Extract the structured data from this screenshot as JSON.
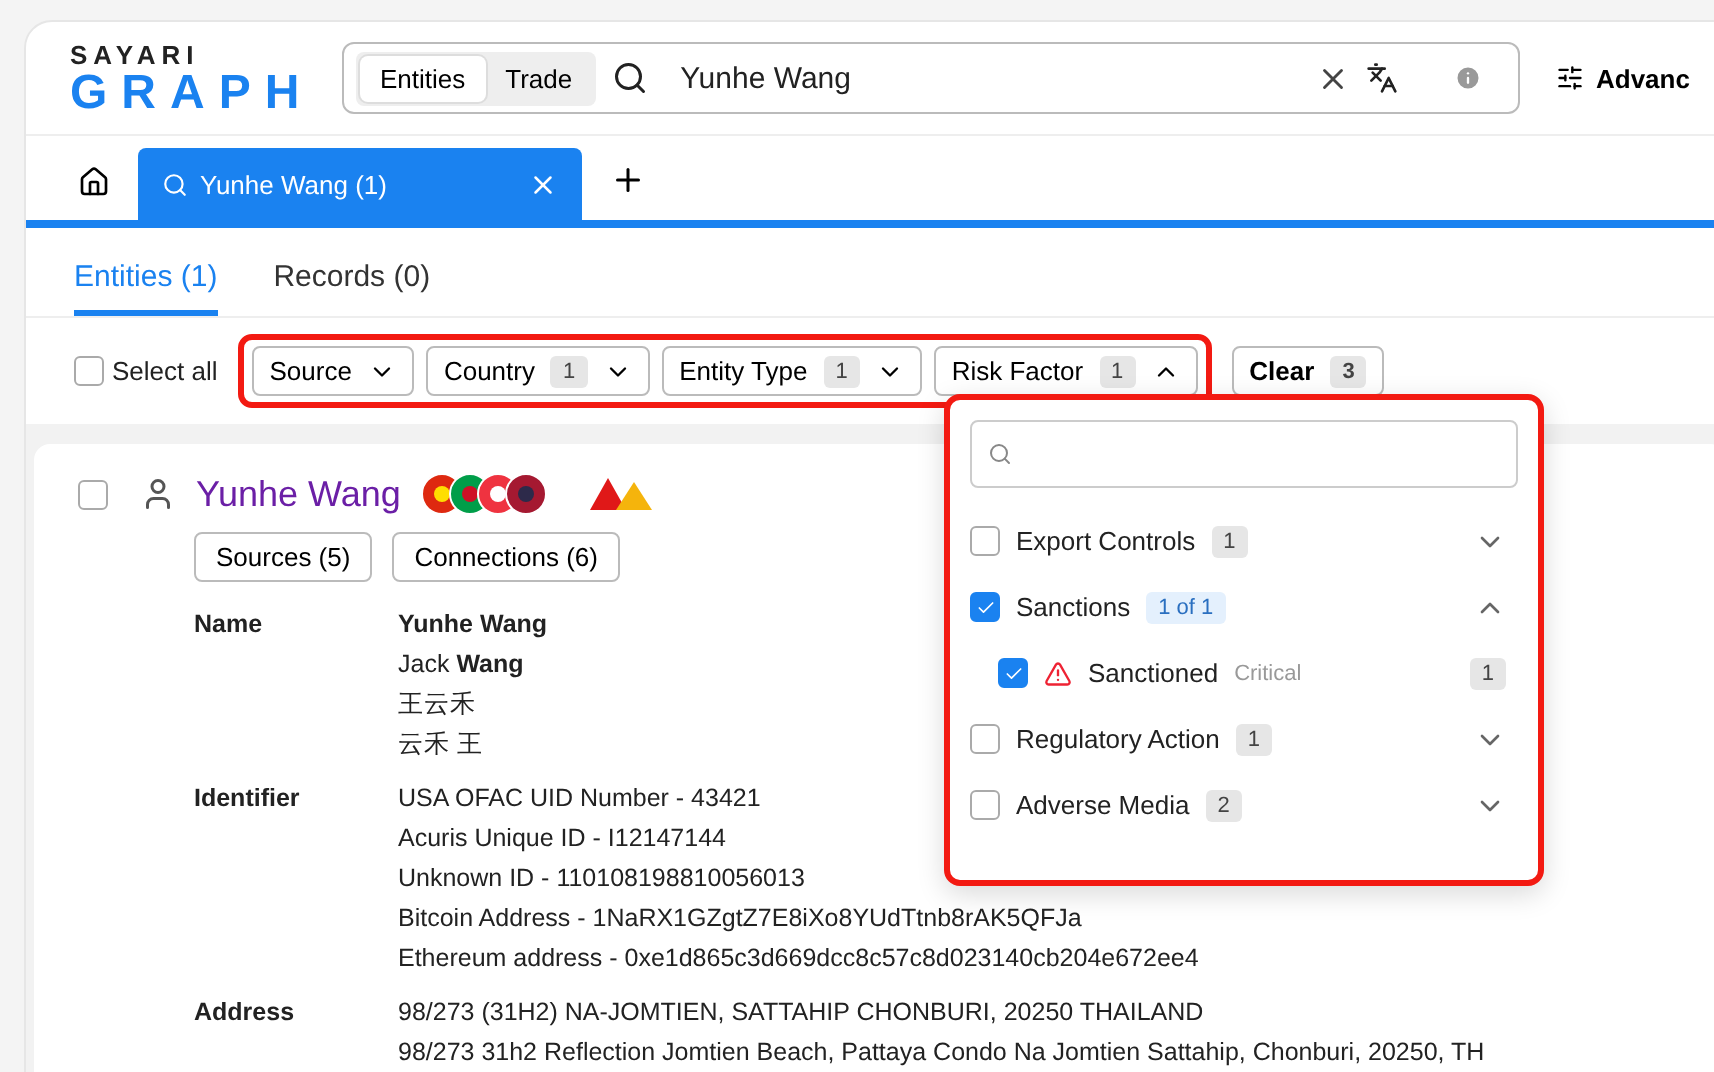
{
  "logo": {
    "top": "SAYARI",
    "bottom": "GRAPH"
  },
  "search": {
    "modes": [
      {
        "label": "Entities",
        "selected": true
      },
      {
        "label": "Trade",
        "selected": false
      }
    ],
    "value": "Yunhe Wang",
    "advanced": "Advanc"
  },
  "tabs": [
    {
      "label": "Yunhe Wang (1)",
      "selected": true
    }
  ],
  "result_tabs": [
    {
      "label": "Entities (1)",
      "selected": true
    },
    {
      "label": "Records (0)",
      "selected": false
    }
  ],
  "filters": {
    "select_all": {
      "label": "Select all",
      "checked": false
    },
    "items": [
      {
        "label": "Source",
        "open": false
      },
      {
        "label": "Country",
        "count": "1",
        "open": false
      },
      {
        "label": "Entity Type",
        "count": "1",
        "open": false
      },
      {
        "label": "Risk Factor",
        "count": "1",
        "open": true
      }
    ],
    "clear": {
      "label": "Clear",
      "count": "3"
    }
  },
  "entity": {
    "name": "Yunhe Wang",
    "checked": false,
    "flags": [
      {
        "kind": "china"
      },
      {
        "kind": "kitts"
      },
      {
        "kind": "singapore"
      },
      {
        "kind": "thailand"
      }
    ],
    "buttons": [
      "Sources (5)",
      "Connections (6)"
    ],
    "fields": [
      {
        "label": "Name",
        "values": [
          "**Yunhe Wang**",
          "Jack **Wang**",
          "王云禾",
          "云禾 王"
        ]
      },
      {
        "label": "Identifier",
        "values": [
          "USA OFAC UID Number - 43421",
          "Acuris Unique ID - I12147144",
          "Unknown ID - 110108198810056013",
          "Bitcoin Address - 1NaRX1GZgtZ7E8iXo8YUdTtnb8rAK5QFJa",
          "Ethereum address - 0xe1d865c3d669dcc8c57c8d023140cb204e672ee4"
        ]
      },
      {
        "label": "Address",
        "values": [
          "98/273 (31H2) NA-JOMTIEN, SATTAHIP CHONBURI, 20250 THAILAND",
          "98/273 31h2 Reflection Jomtien Beach, Pattaya Condo Na Jomtien Sattahip, Chonburi, 20250, TH"
        ]
      }
    ]
  },
  "risk_menu": {
    "items": [
      {
        "label": "Export Controls",
        "count": "1",
        "checked": false,
        "expanded": false
      },
      {
        "label": "Sanctions",
        "count": "1 of 1",
        "checked": true,
        "expanded": true,
        "children": [
          {
            "label": "Sanctioned",
            "level": "Critical",
            "count": "1",
            "checked": true
          }
        ]
      },
      {
        "label": "Regulatory Action",
        "count": "1",
        "checked": false,
        "expanded": false
      },
      {
        "label": "Adverse Media",
        "count": "2",
        "checked": false,
        "expanded": false
      }
    ]
  }
}
